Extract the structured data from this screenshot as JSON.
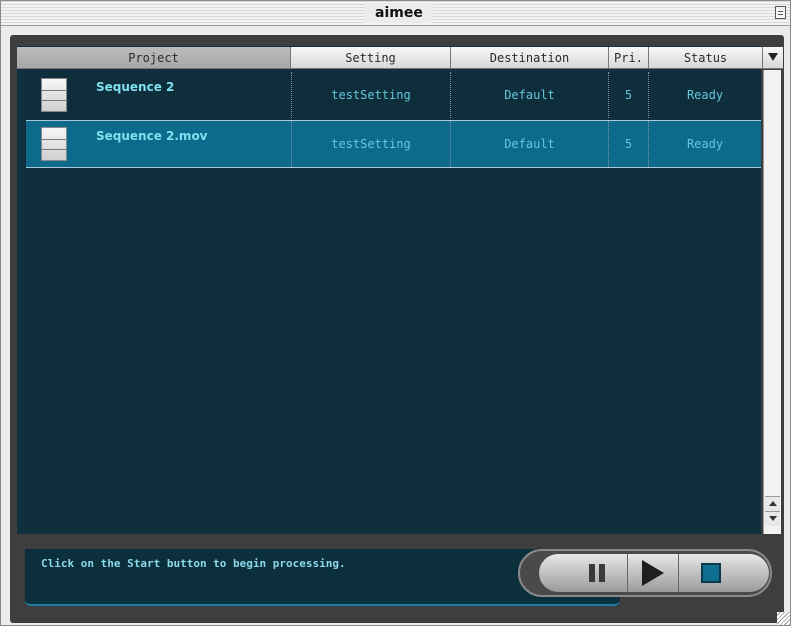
{
  "window": {
    "title": "aimee"
  },
  "table": {
    "columns": [
      "Project",
      "Setting",
      "Destination",
      "Pri.",
      "Status"
    ],
    "rows": [
      {
        "project": "Sequence 2",
        "setting": "testSetting",
        "destination": "Default",
        "priority": "5",
        "status": "Ready"
      },
      {
        "project": "Sequence 2.mov",
        "setting": "testSetting",
        "destination": "Default",
        "priority": "5",
        "status": "Ready"
      }
    ],
    "selected_row": 1
  },
  "status": {
    "message": "Click on the Start button to begin processing."
  },
  "controls": {
    "pause_icon": "pause-icon",
    "play_icon": "play-icon",
    "stop_icon": "stop-icon"
  },
  "colors": {
    "panel_bg": "#0f2f3c",
    "selected_row": "#0d6a8a",
    "text_cyan": "#66c7da"
  }
}
